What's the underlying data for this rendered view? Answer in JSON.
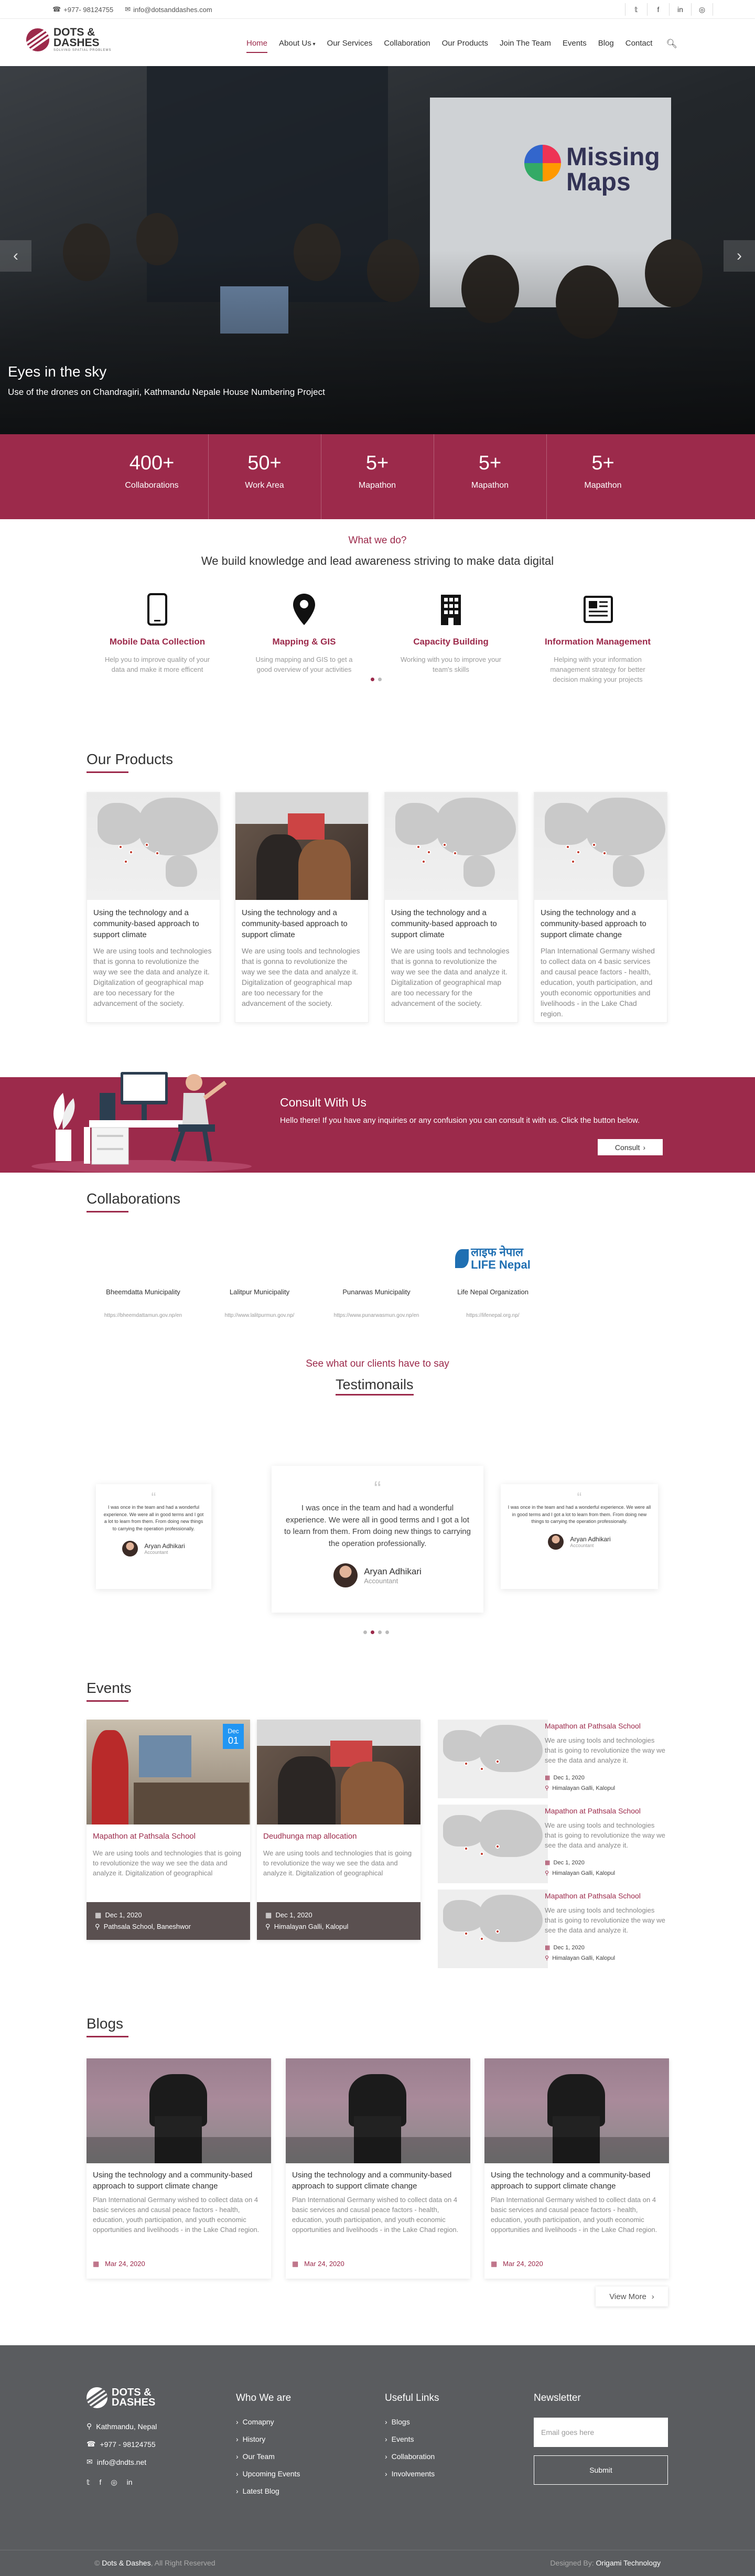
{
  "topbar": {
    "phone": "+977- 98124755",
    "email": "info@dotsanddashes.com",
    "social_icons": [
      "twitter-icon",
      "facebook-icon",
      "linkedin-icon",
      "instagram-icon"
    ]
  },
  "logo": {
    "line1": "DOTS &",
    "line2": "DASHES",
    "tag": "SOLVING SPATIAL PROBLEMS"
  },
  "nav": {
    "items": [
      "Home",
      "About Us",
      "Our Services",
      "Collaboration",
      "Our Products",
      "Join The Team",
      "Events",
      "Blog",
      "Contact"
    ],
    "active": "Home"
  },
  "hero": {
    "title": "Eyes in the sky",
    "subtitle": "Use of the drones on Chandragiri, Kathmandu Nepale House Numbering Project",
    "sign_line1": "Missing",
    "sign_line2": "Maps"
  },
  "stats": [
    {
      "value": "400+",
      "label": "Collaborations"
    },
    {
      "value": "50+",
      "label": "Work Area"
    },
    {
      "value": "5+",
      "label": "Mapathon"
    },
    {
      "value": "5+",
      "label": "Mapathon"
    },
    {
      "value": "5+",
      "label": "Mapathon"
    }
  ],
  "what": {
    "heading": "What we do?",
    "subheading": "We build knowledge and lead awareness striving to make data digital"
  },
  "services": [
    {
      "icon": "mobile-phone-icon",
      "title": "Mobile Data Collection",
      "desc": "Help you to improve quality of your data and make it more efficent"
    },
    {
      "icon": "map-pin-icon",
      "title": "Mapping & GIS",
      "desc": "Using mapping and GIS to get a good overview of your activities"
    },
    {
      "icon": "building-icon",
      "title": "Capacity Building",
      "desc": "Working with you to improve your team's skills"
    },
    {
      "icon": "newspaper-icon",
      "title": "Information Management",
      "desc": "Helping with your information management strategy for better decision making your projects"
    }
  ],
  "products": {
    "heading": "Our Products",
    "items": [
      {
        "title": "Using the technology and a community-based approach to support climate",
        "desc": "We are using tools and technologies that is gonna to revolutionize the way we see the data and analyze it. Digitalization of geographical map are too necessary for the advancement of the society."
      },
      {
        "title": "Using the technology and a community-based approach to support climate",
        "desc": "We are using tools and technologies that is gonna to revolutionize the way we see the data and analyze it. Digitalization of geographical map are too necessary for the advancement of the society."
      },
      {
        "title": "Using the technology and a community-based approach to support climate",
        "desc": "We are using tools and technologies that is gonna to revolutionize the way we see the data and analyze it. Digitalization of geographical map are too necessary for the advancement of the society."
      },
      {
        "title": "Using the technology and a community-based approach to support climate change",
        "desc": "Plan International Germany wished to collect data on 4 basic services and causal peace factors - health, education, youth participation, and youth economic opportunities and livelihoods - in the Lake Chad region."
      }
    ]
  },
  "consult": {
    "title": "Consult With Us",
    "text": "Hello there! If you have any inquiries or any confusion you can consult it with us. Click the button below.",
    "button": "Consult"
  },
  "collaborations": {
    "heading": "Collaborations",
    "items": [
      {
        "name": "Bheemdatta Municipality",
        "url": "https://bheemdattamun.gov.np/en"
      },
      {
        "name": "Lalitpur Municipality",
        "url": "http://www.lalitpurmun.gov.np/"
      },
      {
        "name": "Punarwas Municipality",
        "url": "https://www.punarwasmun.gov.np/en"
      },
      {
        "name": "Life Nepal Organization",
        "url": "https://lifenepal.org.np/"
      }
    ],
    "life_logo_text": "लाइफ नेपाल",
    "life_logo_sub": "LIFE Nepal"
  },
  "testimonials": {
    "kicker": "See what our clients have to say",
    "heading": "Testimonails",
    "quote": "I was once in the team and had a wonderful experience. We were all in good terms and I got a lot to learn from them. From doing new things to carrying the operation professionally.",
    "name": "Aryan Adhikari",
    "role": "Accountant"
  },
  "events": {
    "heading": "Events",
    "featured": [
      {
        "title": "Mapathon at Pathsala School",
        "desc": "We are using tools and technologies that is going to revolutionize the way we see the data and analyze it. Digitalization of geographical",
        "date": "Dec 1, 2020",
        "location": "Pathsala School, Baneshwor",
        "badge_month": "Dec",
        "badge_day": "01"
      },
      {
        "title": "Deudhunga map allocation",
        "desc": "We are using tools and technologies that is going to revolutionize the way we see the data and analyze it. Digitalization of geographical",
        "date": "Dec 1, 2020",
        "location": "Himalayan Galli, Kalopul"
      }
    ],
    "list": [
      {
        "title": "Mapathon at Pathsala School",
        "desc": "We are using tools and technologies that is going to revolutionize the way we see the data and analyze it.",
        "date": "Dec 1, 2020",
        "location": "Himalayan Galli, Kalopul"
      },
      {
        "title": "Mapathon at Pathsala School",
        "desc": "We are using tools and technologies that is going to revolutionize the way we see the data and analyze it.",
        "date": "Dec 1, 2020",
        "location": "Himalayan Galli, Kalopul"
      },
      {
        "title": "Mapathon at Pathsala School",
        "desc": "We are using tools and technologies that is going to revolutionize the way we see the data and analyze it.",
        "date": "Dec 1, 2020",
        "location": "Himalayan Galli, Kalopul"
      }
    ]
  },
  "blogs": {
    "heading": "Blogs",
    "items": [
      {
        "title": "Using the technology and a community-based approach to support climate change",
        "desc": "Plan International Germany wished to collect data on 4 basic services and causal peace factors - health, education, youth participation, and youth economic opportunities and livelihoods - in the Lake Chad region.",
        "date": "Mar 24, 2020"
      },
      {
        "title": "Using the technology and a community-based approach to support climate change",
        "desc": "Plan International Germany wished to collect data on 4 basic services and causal peace factors - health, education, youth participation, and youth economic opportunities and livelihoods - in the Lake Chad region.",
        "date": "Mar 24, 2020"
      },
      {
        "title": "Using the technology and a community-based approach to support climate change",
        "desc": "Plan International Germany wished to collect data on 4 basic services and causal peace factors - health, education, youth participation, and youth economic opportunities and livelihoods - in the Lake Chad region.",
        "date": "Mar 24, 2020"
      }
    ],
    "view_more": "View More"
  },
  "footer": {
    "address": "Kathmandu, Nepal",
    "phone": "+977 - 98124755",
    "email": "info@dndts.net",
    "who_heading": "Who We are",
    "who_links": [
      "Comapny",
      "History",
      "Our Team",
      "Upcoming Events",
      "Latest Blog"
    ],
    "useful_heading": "Useful Links",
    "useful_links": [
      "Blogs",
      "Events",
      "Collaboration",
      "Involvements"
    ],
    "newsletter_heading": "Newsletter",
    "newsletter_placeholder": "Email goes here",
    "submit": "Submit",
    "copyright_brand": "Dots & Dashes",
    "copyright_rest": ", All Right Reserved",
    "designed_by": "Designed By:",
    "designer": "Origami Technology"
  },
  "colors": {
    "brand": "#9c2a4b",
    "footer": "#5a5c5f"
  }
}
